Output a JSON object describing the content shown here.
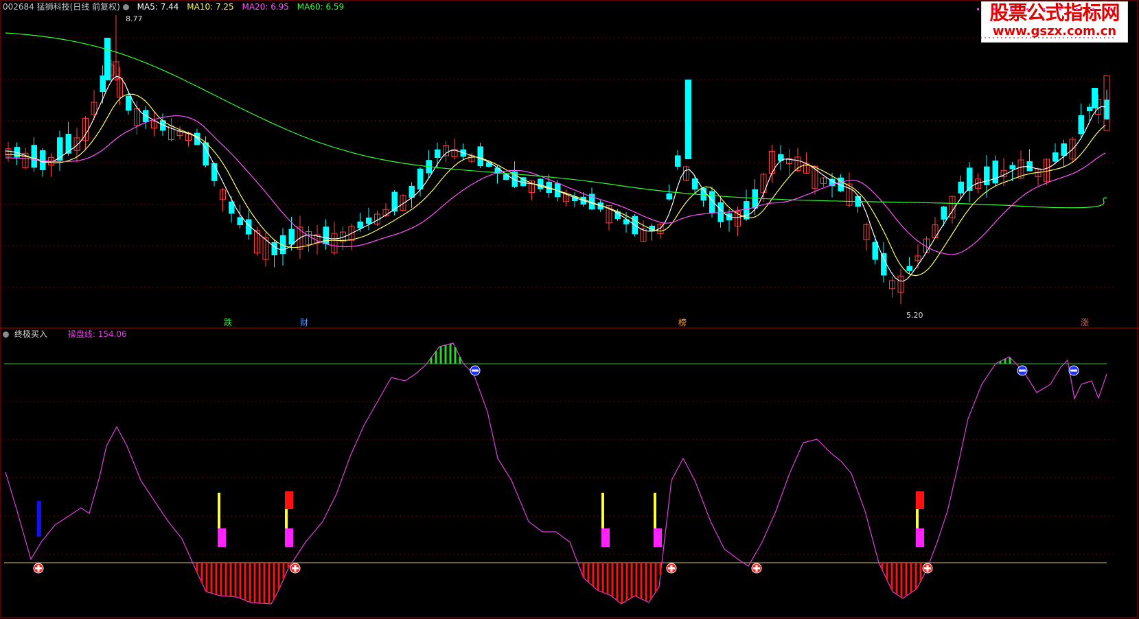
{
  "header": {
    "symbol_title": "002684 猛狮科技(日线 前复权)",
    "ma5": "MA5: 7.44",
    "ma10": "MA10: 7.25",
    "ma20": "MA20: 6.95",
    "ma60": "MA60: 6.59",
    "colors": {
      "ma5": "#ffffff",
      "ma10": "#ffff66",
      "ma20": "#ff55ff",
      "ma60": "#33ff33"
    }
  },
  "price_panel": {
    "high_label": "8.77",
    "low_label": "5.20",
    "event_markers": [
      {
        "text": "跌",
        "color": "#33ff33"
      },
      {
        "text": "财",
        "color": "#5599ff"
      },
      {
        "text": "榜",
        "color": "#ffaa33"
      },
      {
        "text": "涨",
        "color": "#ff5555"
      }
    ]
  },
  "indicator": {
    "name": "终极买入",
    "line_label": "操盘线: 154.06",
    "line_color": "#e040e0"
  },
  "watermark": {
    "line1": "股票公式指标网",
    "line2": "www.gszx.com.cn"
  },
  "colors": {
    "up_candle": "#ff4040",
    "down_candle": "#00ffff",
    "grid": "#7a0000",
    "separator": "#b00000"
  }
}
